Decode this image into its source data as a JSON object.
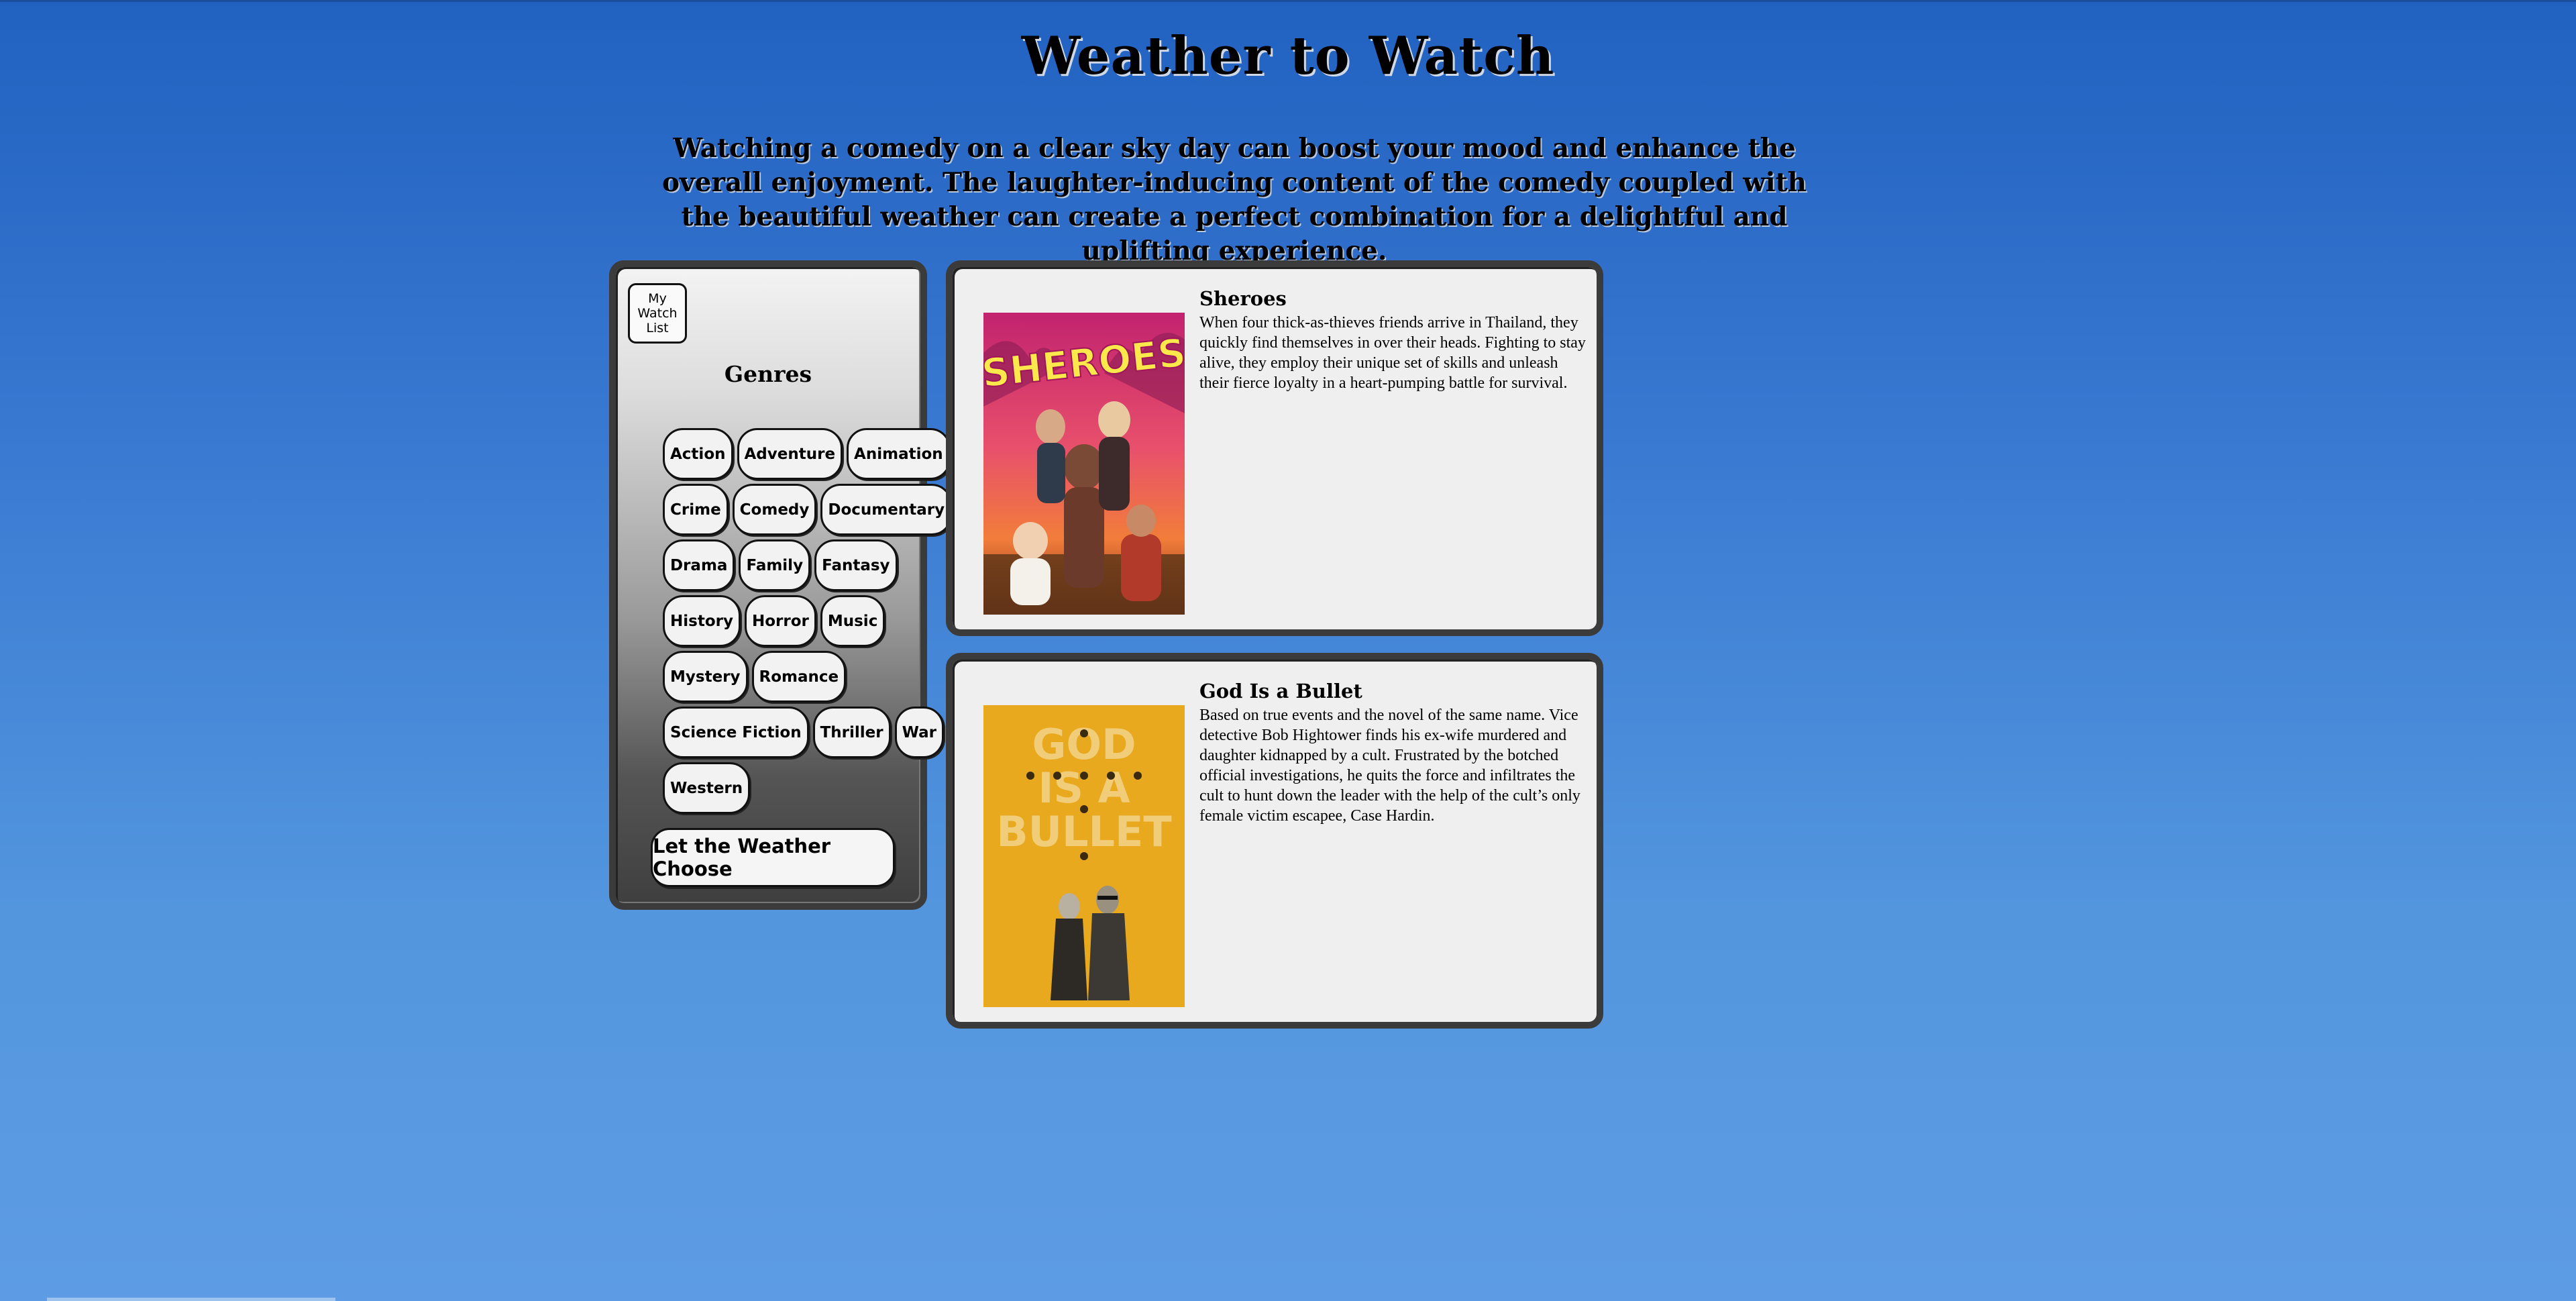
{
  "page": {
    "title": "Weather to Watch",
    "intro": "Watching a comedy on a clear sky day can boost your mood and enhance the overall enjoyment. The laughter-inducing content of the comedy coupled with the beautiful weather can create a perfect combination for a delightful and uplifting experience."
  },
  "sidebar": {
    "watchlist_label": "My Watch List",
    "genres_heading": "Genres",
    "genres": [
      "Action",
      "Adventure",
      "Animation",
      "Crime",
      "Comedy",
      "Documentary",
      "Drama",
      "Family",
      "Fantasy",
      "History",
      "Horror",
      "Music",
      "Mystery",
      "Romance",
      "Science Fiction",
      "Thriller",
      "War",
      "Western"
    ],
    "weather_button": "Let the Weather Choose"
  },
  "movies": [
    {
      "title": "Sheroes",
      "description": "When four thick-as-thieves friends arrive in Thailand, they quickly find themselves in over their heads. Fighting to stay alive, they employ their unique set of skills and unleash their fierce loyalty in a heart-pumping battle for survival.",
      "poster_text": "SHEROES"
    },
    {
      "title": "God Is a Bullet",
      "description": "Based on true events and the novel of the same name. Vice detective Bob Hightower finds his ex-wife murdered and daughter kidnapped by a cult. Frustrated by the botched official investigations, he quits the force and infiltrates the cult to hunt down the leader with the help of the cult’s only female victim escapee, Case Hardin.",
      "poster_text": [
        "GOD",
        "IS A",
        "BULLET"
      ]
    }
  ],
  "colors": {
    "sky_top": "#2161c0",
    "sky_bottom": "#5d9ce4",
    "panel_border": "#3b3b3b",
    "card_bg": "#efefef",
    "sheroes_poster_pink": "#e23a7a",
    "bullet_poster_yellow": "#e8a91f"
  }
}
